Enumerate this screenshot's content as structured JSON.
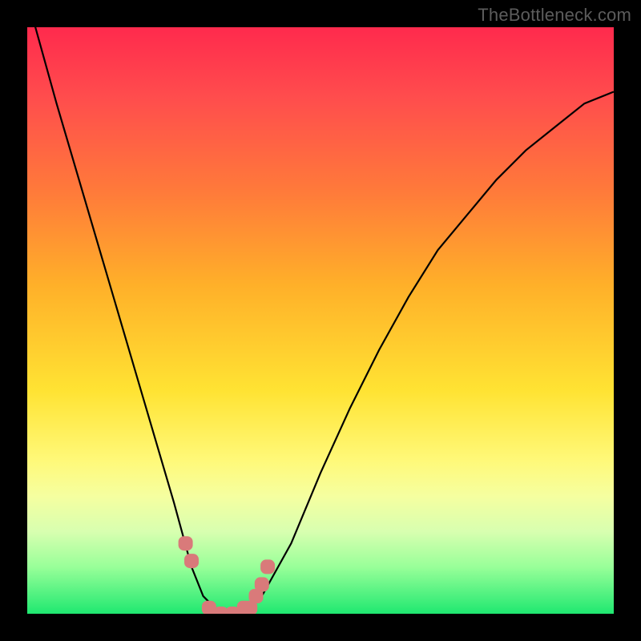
{
  "watermark": "TheBottleneck.com",
  "chart_data": {
    "type": "line",
    "title": "",
    "xlabel": "",
    "ylabel": "",
    "xlim": [
      0,
      100
    ],
    "ylim": [
      0,
      100
    ],
    "x": [
      0,
      5,
      10,
      15,
      20,
      25,
      28,
      30,
      32,
      34,
      36,
      38,
      40,
      45,
      50,
      55,
      60,
      65,
      70,
      75,
      80,
      85,
      90,
      95,
      100
    ],
    "values": [
      105,
      87,
      70,
      53,
      36,
      19,
      8,
      3,
      1,
      0,
      0,
      1,
      3,
      12,
      24,
      35,
      45,
      54,
      62,
      68,
      74,
      79,
      83,
      87,
      89
    ],
    "markers": {
      "x": [
        27,
        28,
        31,
        33,
        35,
        37,
        38,
        39,
        40,
        41
      ],
      "y": [
        12,
        9,
        1,
        0,
        0,
        1,
        1,
        3,
        5,
        8
      ],
      "color": "#d97a7a"
    },
    "background": "rainbow-vertical-gradient"
  }
}
